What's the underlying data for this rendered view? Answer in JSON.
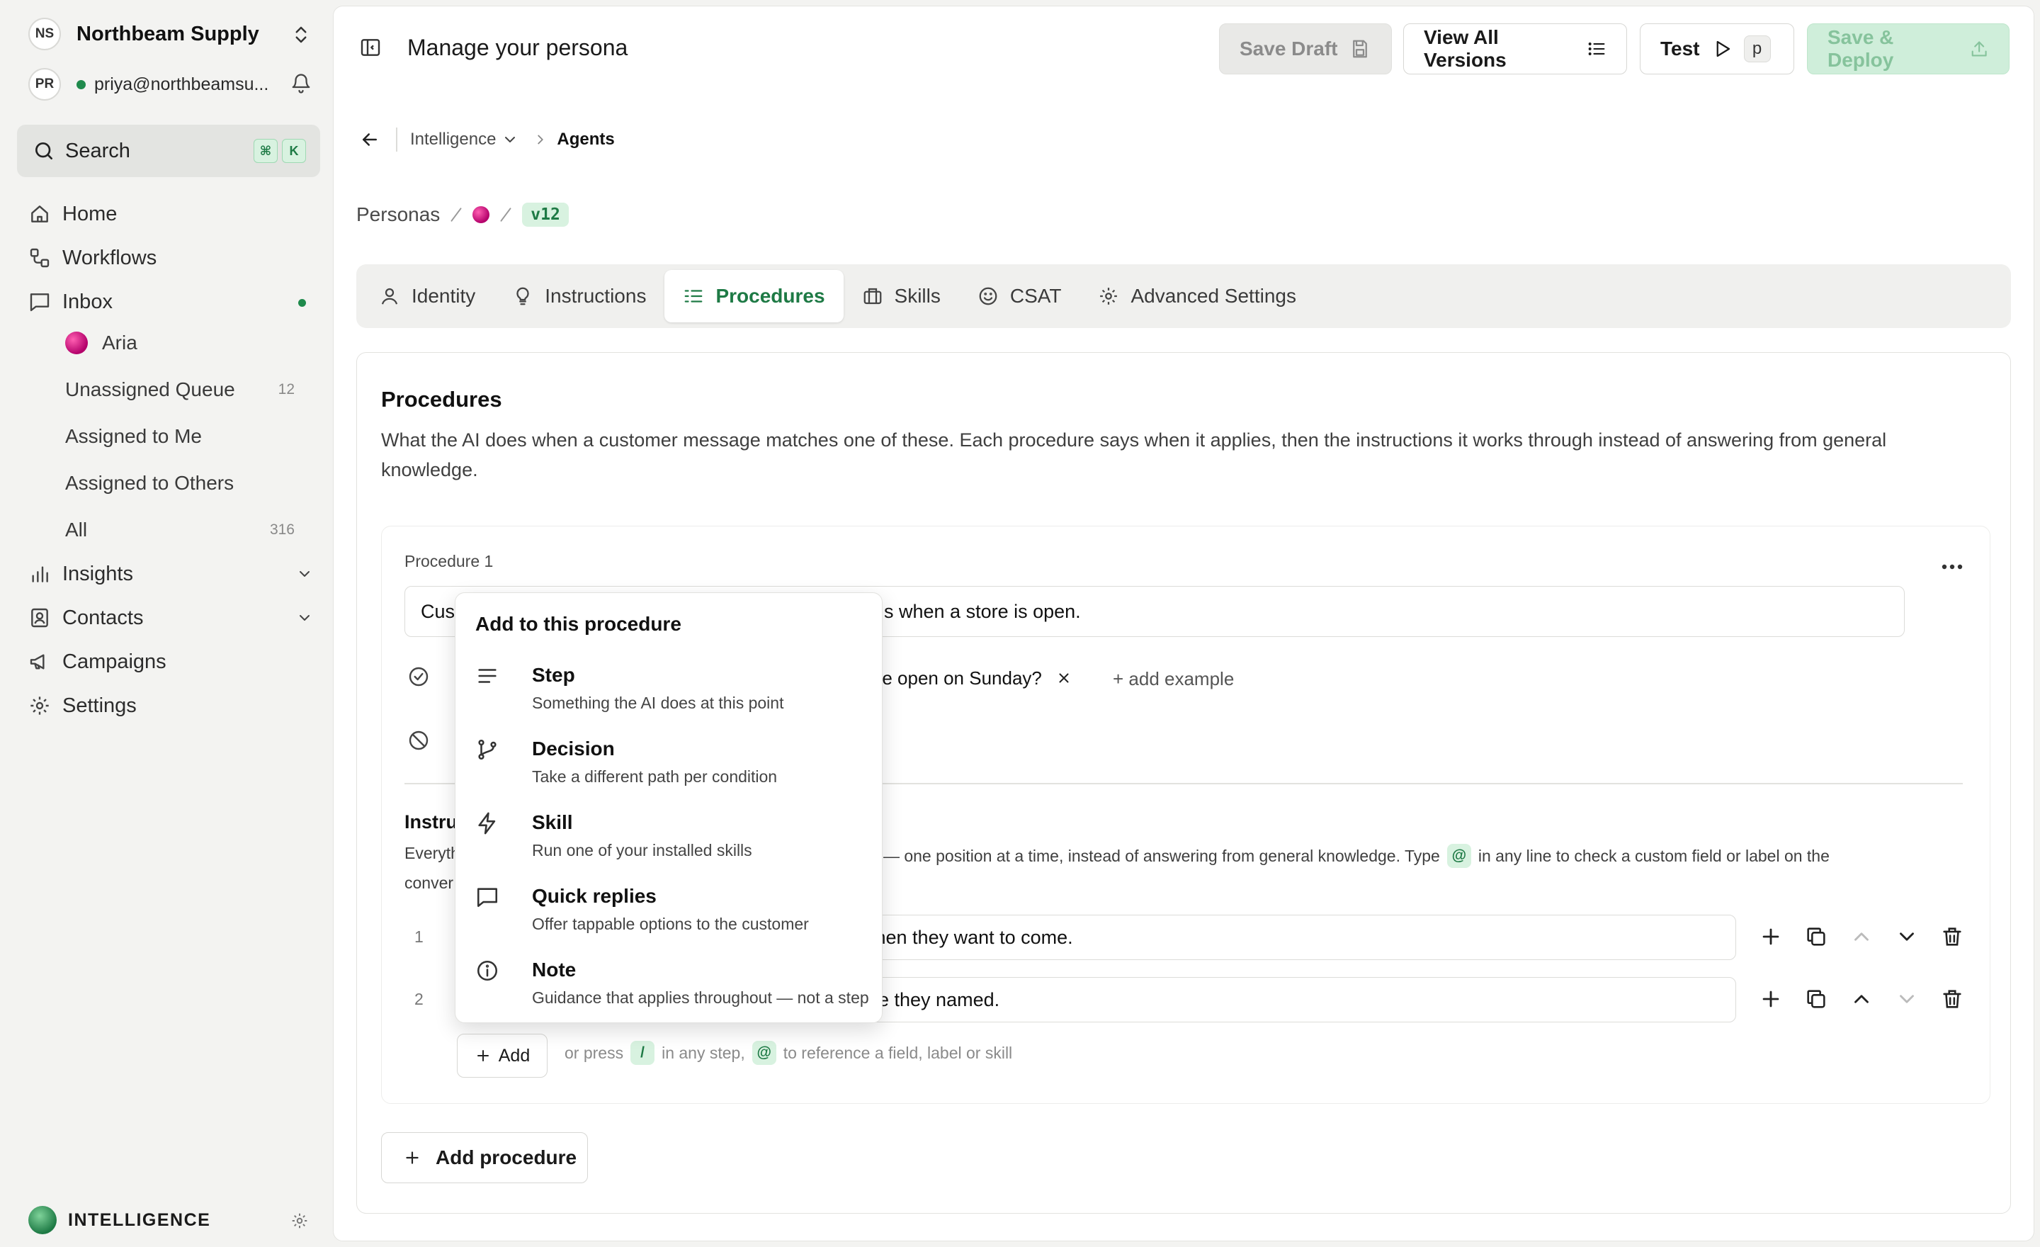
{
  "workspace": {
    "initials": "NS",
    "name": "Northbeam Supply"
  },
  "user": {
    "initials": "PR",
    "email": "priya@northbeamsu..."
  },
  "search": {
    "label": "Search",
    "kbd": [
      "⌘",
      "K"
    ]
  },
  "nav": {
    "home": "Home",
    "workflows": "Workflows",
    "inbox": "Inbox",
    "inbox_sub": [
      {
        "label": "Aria",
        "count": ""
      },
      {
        "label": "Unassigned Queue",
        "count": "12"
      },
      {
        "label": "Assigned to Me",
        "count": ""
      },
      {
        "label": "Assigned to Others",
        "count": ""
      },
      {
        "label": "All",
        "count": "316"
      }
    ],
    "insights": "Insights",
    "contacts": "Contacts",
    "campaigns": "Campaigns",
    "settings": "Settings"
  },
  "footer": {
    "brand": "INTELLIGENCE"
  },
  "header": {
    "title": "Manage your persona",
    "save_draft": "Save Draft",
    "view_versions": "View All Versions",
    "test": "Test",
    "test_key": "p",
    "deploy": "Save & Deploy"
  },
  "breadcrumb": {
    "section": "Intelligence",
    "current": "Agents"
  },
  "persona_path": {
    "root": "Personas",
    "version": "v12"
  },
  "tabs": [
    "Identity",
    "Instructions",
    "Procedures",
    "Skills",
    "CSAT",
    "Advanced Settings"
  ],
  "procedures": {
    "heading": "Procedures",
    "description": "What the AI does when a customer message matches one of these. Each procedure says when it applies, then the instructions it works through instead of answering from general knowledge.",
    "items": [
      {
        "label": "Procedure 1",
        "trigger_head": "Cust",
        "trigger_tail": "s when a store is open.",
        "example": "tore open on Sunday?",
        "add_example": "+ add example",
        "instructions_heading": "Instru",
        "instructions_desc_a": "Everyth",
        "instructions_desc_b1": "ler — one position at a time, instead of answering from general knowledge. Type",
        "instructions_desc_b2": "in any line to check a custom field or label on the",
        "instructions_desc_c": "conver",
        "at": "@",
        "steps": [
          {
            "num": "1",
            "tail": "when they want to come."
          },
          {
            "num": "2",
            "tail": "ore they named."
          }
        ]
      }
    ],
    "add_label": "Add",
    "hint_a": "or press",
    "hint_slash": "/",
    "hint_b": "in any step,",
    "hint_at": "@",
    "hint_c": "to reference a field, label or skill",
    "add_procedure": "Add procedure"
  },
  "menu": {
    "title": "Add to this procedure",
    "items": [
      {
        "title": "Step",
        "desc": "Something the AI does at this point",
        "icon": "lines-icon"
      },
      {
        "title": "Decision",
        "desc": "Take a different path per condition",
        "icon": "branch-icon"
      },
      {
        "title": "Skill",
        "desc": "Run one of your installed skills",
        "icon": "bolt-icon"
      },
      {
        "title": "Quick replies",
        "desc": "Offer tappable options to the customer",
        "icon": "chat-icon"
      },
      {
        "title": "Note",
        "desc": "Guidance that applies throughout — not a step",
        "icon": "info-icon"
      }
    ]
  },
  "colors": {
    "accent": "#1e7a45",
    "accent_soft": "#d8f2e0",
    "deploy_bg": "#cfeeda"
  }
}
